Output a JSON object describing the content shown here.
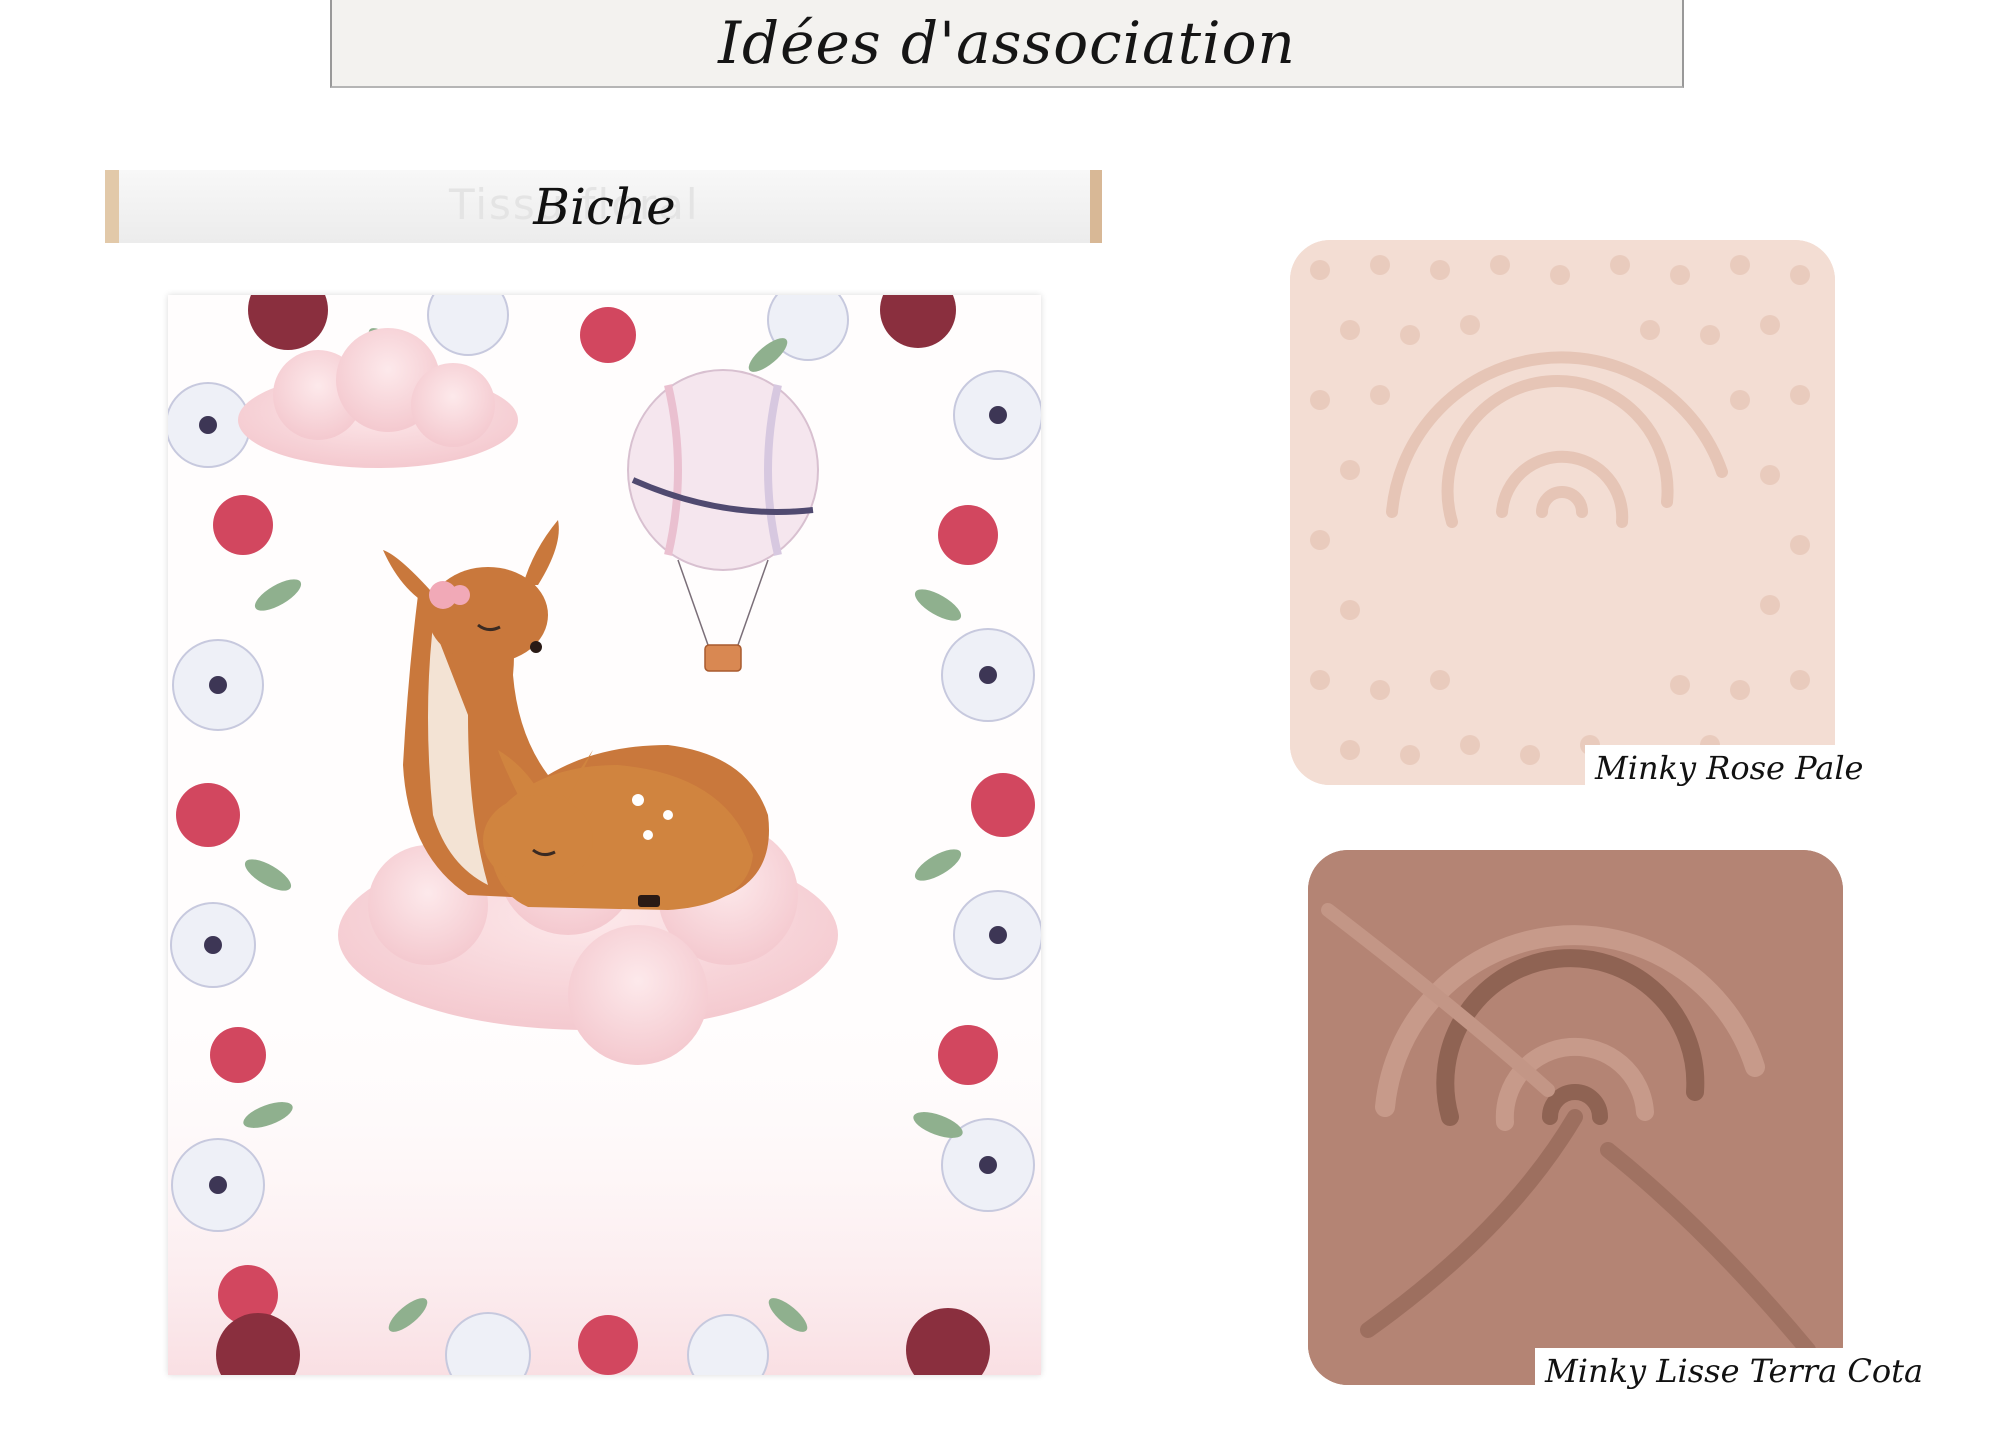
{
  "header": {
    "title": "Idées d'association"
  },
  "fabric": {
    "name": "Biche",
    "roll_faint_text": "Tissu          floral"
  },
  "swatches": [
    {
      "label": "Minky Rose Pale",
      "color": "#f3ddd3"
    },
    {
      "label": "Minky Lisse Terra Cota",
      "color": "#b48474"
    }
  ],
  "colors": {
    "flower_red": "#d2475f",
    "flower_burgundy": "#8a2f3e",
    "leaf": "#8fb08e",
    "cloud": "#f8d9dc",
    "deer": "#c9783c"
  }
}
